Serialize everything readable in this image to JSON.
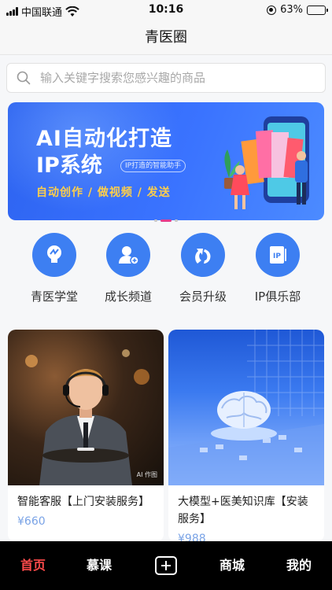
{
  "status_bar": {
    "carrier": "中国联通",
    "time": "10:16",
    "battery_text": "63%",
    "battery_level": 0.63
  },
  "header": {
    "title": "青医圈"
  },
  "search": {
    "placeholder": "输入关键字搜索您感兴趣的商品",
    "icon": "search-icon"
  },
  "banner": {
    "title_line1": "AI自动化打造",
    "title_line2": "IP系统",
    "tag": "IP打造的智能助手",
    "subtitle": "自动创作 / 做视频 / 发送",
    "slides": 3,
    "active_slide": 2,
    "accent": "#3a73ff"
  },
  "quick_entries": [
    {
      "label": "青医学堂",
      "icon": "lightbulb-icon"
    },
    {
      "label": "成长频道",
      "icon": "user-add-icon"
    },
    {
      "label": "会员升级",
      "icon": "upgrade-icon"
    },
    {
      "label": "IP俱乐部",
      "icon": "ip-card-icon"
    }
  ],
  "products": [
    {
      "title": "智能客服【上门安装服务】",
      "price": "¥660",
      "image_caption": "AI 作图"
    },
    {
      "title": "大模型+医美知识库【安装服务】",
      "price": "¥988"
    }
  ],
  "tabbar": {
    "items": [
      {
        "label": "首页",
        "active": true
      },
      {
        "label": "慕课",
        "active": false
      },
      {
        "label": "",
        "icon": "add-icon",
        "active": false
      },
      {
        "label": "商城",
        "active": false
      },
      {
        "label": "我的",
        "active": false
      }
    ],
    "active_color": "#ff4b4b"
  }
}
